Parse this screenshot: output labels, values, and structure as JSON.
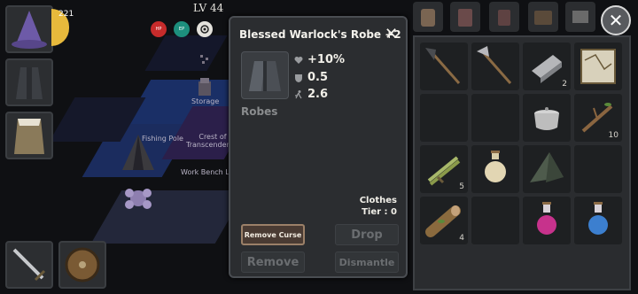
{
  "hud": {
    "level": "LV 44",
    "hp_label": "HP",
    "ep_label": "EP",
    "player_level_badge": "221"
  },
  "world_labels": {
    "storage": "Storage",
    "fishing_pole": "Fishing Pole",
    "crest": "Crest of\nTranscendence",
    "workbench": "Work Bench Lv"
  },
  "item_popup": {
    "title": "Blessed Warlock's Robe +2",
    "stats": [
      {
        "icon": "heart-icon",
        "value": "+10%"
      },
      {
        "icon": "shield-icon",
        "value": "0.5"
      },
      {
        "icon": "running-icon",
        "value": "2.6"
      }
    ],
    "item_type": "Robes",
    "category": "Clothes",
    "tier": "Tier : 0",
    "buttons": {
      "remove_curse": "Remove Curse",
      "drop": "Drop",
      "remove": "Remove",
      "dismantle": "Dismantle"
    }
  },
  "inventory": {
    "items": [
      {
        "name": "shovel-icon",
        "qty": ""
      },
      {
        "name": "axe-icon",
        "qty": ""
      },
      {
        "name": "iron-ingot-icon",
        "qty": "2"
      },
      {
        "name": "map-icon",
        "qty": ""
      },
      {
        "name": "empty",
        "qty": ""
      },
      {
        "name": "empty",
        "qty": ""
      },
      {
        "name": "cooking-pot-icon",
        "qty": ""
      },
      {
        "name": "branch-icon",
        "qty": "10"
      },
      {
        "name": "wheat-bundle-icon",
        "qty": "5"
      },
      {
        "name": "flask-icon",
        "qty": ""
      },
      {
        "name": "tent-icon",
        "qty": ""
      },
      {
        "name": "empty",
        "qty": ""
      },
      {
        "name": "wood-log-icon",
        "qty": "4"
      },
      {
        "name": "empty",
        "qty": ""
      },
      {
        "name": "red-potion-icon",
        "qty": ""
      },
      {
        "name": "blue-potion-icon",
        "qty": ""
      }
    ]
  },
  "colors": {
    "hp": "#c62b2b",
    "ep": "#1d8f7d",
    "active_button": "#4a3b33",
    "panel": "#2b2d30"
  }
}
